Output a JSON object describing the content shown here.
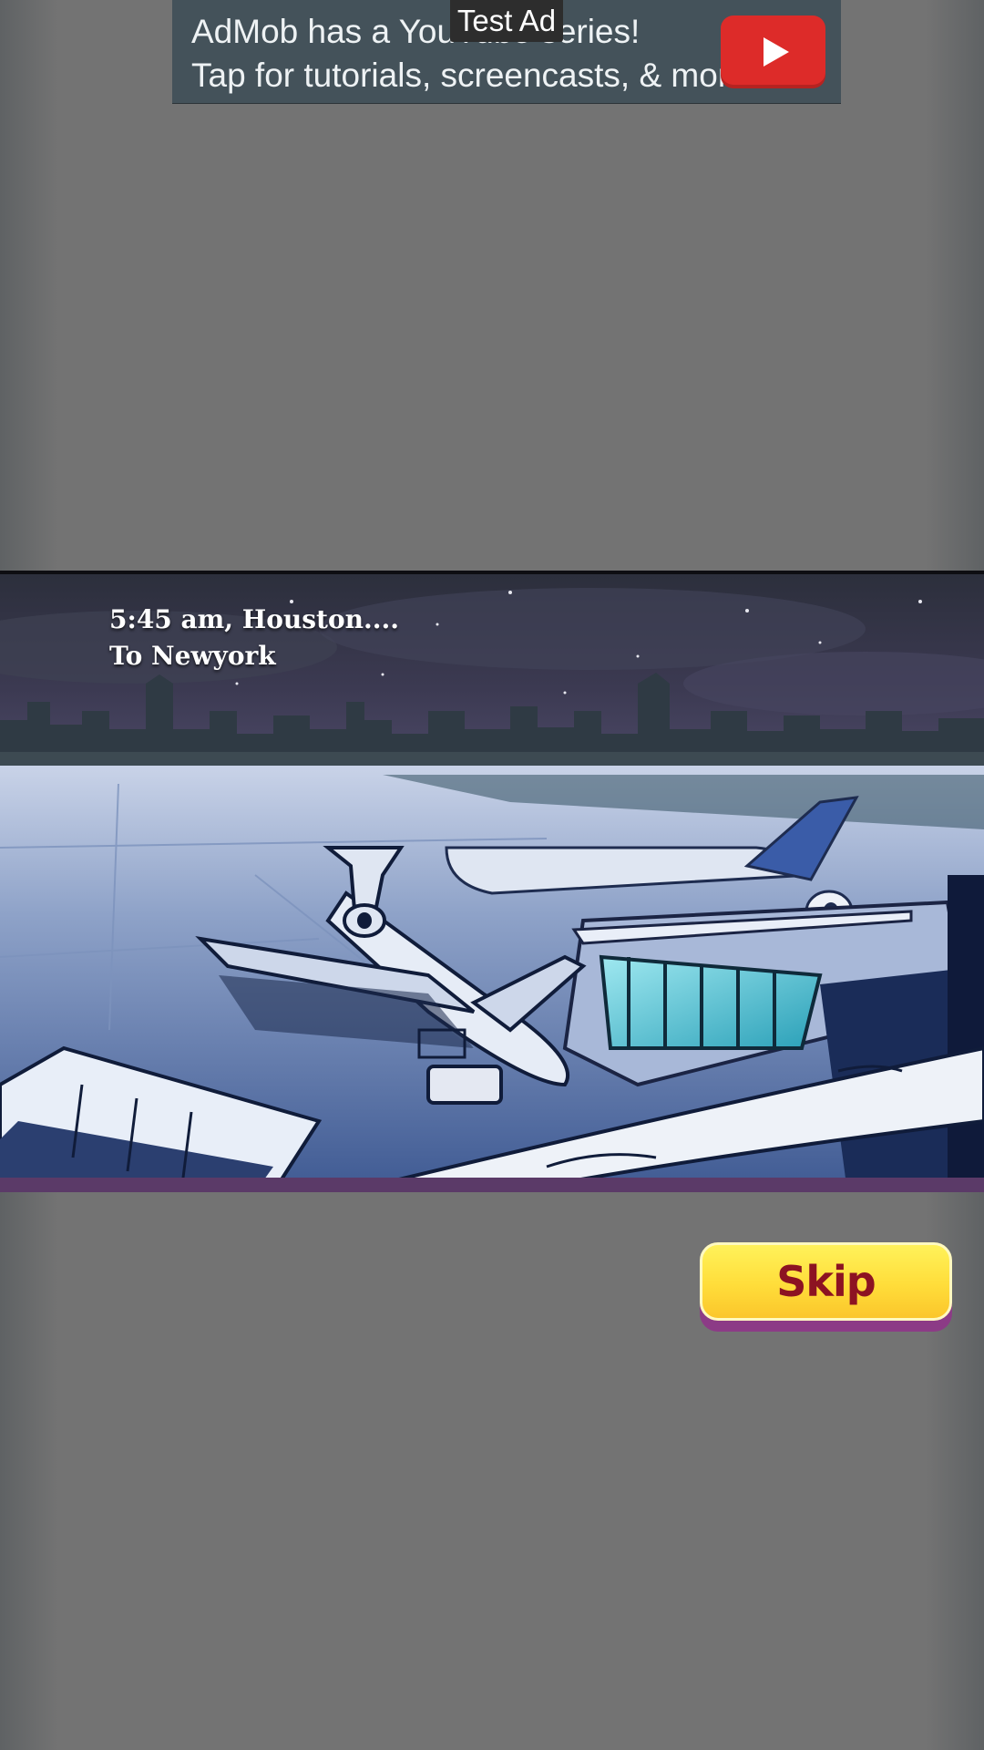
{
  "ad": {
    "test_label": "Test Ad",
    "line1": "AdMob has a YouTube series!",
    "line2": "Tap for tutorials, screencasts, & more.",
    "button_icon": "play-icon",
    "colors": {
      "background": "#44525a",
      "button": "#dd2b29"
    }
  },
  "cutscene": {
    "caption_line1": "5:45 am, Houston....",
    "caption_line2": "To Newyork"
  },
  "skip": {
    "label": "Skip",
    "colors": {
      "face": "#ffdd3a",
      "text": "#8c1322",
      "shadow": "#8c3b86"
    }
  },
  "colors": {
    "page_background": "#737373"
  }
}
